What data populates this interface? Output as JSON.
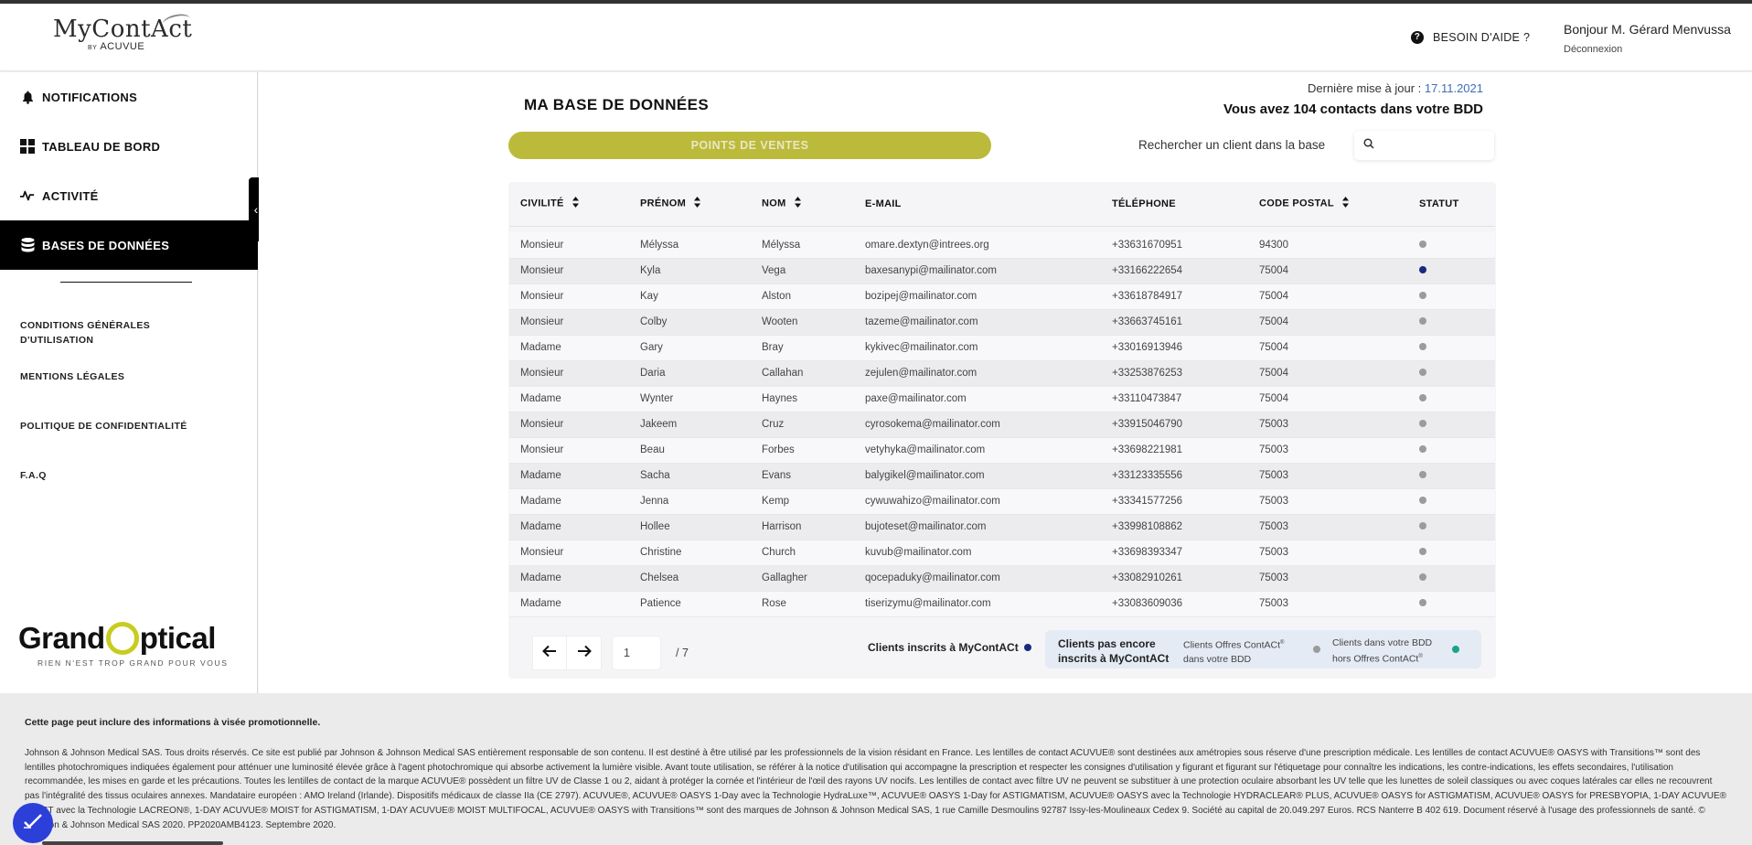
{
  "header": {
    "logo_main": "MyContAct",
    "logo_by": "BY",
    "logo_brand": "ACUVUE",
    "help_label": "BESOIN D'AIDE ?",
    "help_icon_text": "?",
    "greeting": "Bonjour M. Gérard Menvussa",
    "logout_label": "Déconnexion"
  },
  "sidebar": {
    "nav": [
      {
        "label": "NOTIFICATIONS",
        "icon": "bell-icon"
      },
      {
        "label": "TABLEAU DE BORD",
        "icon": "dashboard-grid-icon"
      },
      {
        "label": "ACTIVITÉ",
        "icon": "activity-pulse-icon"
      },
      {
        "label": "BASES DE DONNÉES",
        "icon": "database-icon",
        "active": true
      }
    ],
    "links": [
      {
        "line1": "CONDITIONS GÉNÉRALES",
        "line2": "D'UTILISATION"
      },
      {
        "line1": "MENTIONS LÉGALES"
      },
      {
        "line1": "POLITIQUE DE CONFIDENTIALITÉ"
      },
      {
        "line1": "F.A.Q"
      }
    ],
    "collapse_glyph": "‹",
    "partner_logo": {
      "pre": "Grand",
      "post": "ptical",
      "tagline": "RIEN N'EST TROP GRAND POUR VOUS",
      "accent": "#c8cc1f"
    }
  },
  "main": {
    "title": "MA BASE DE DONNÉES",
    "update_prefix": "Dernière mise à jour : ",
    "update_date": "17.11.2021",
    "contacts_text": "Vous avez 104 contacts dans votre BDD",
    "tab_label": "POINTS DE VENTES",
    "search_label": "Rechercher un client dans la base",
    "search_placeholder": ""
  },
  "table": {
    "columns": [
      "CIVILITÉ",
      "PRÉNOM",
      "NOM",
      "E-MAIL",
      "TÉLÉPHONE",
      "CODE POSTAL",
      "STATUT"
    ],
    "sortable": [
      true,
      true,
      true,
      false,
      false,
      true,
      false
    ],
    "rows": [
      [
        "Monsieur",
        "Mélyssa",
        "Mélyssa",
        "omare.dextyn@intrees.org",
        "+33631670951",
        "94300",
        "grey"
      ],
      [
        "Monsieur",
        "Kyla",
        "Vega",
        "baxesanypi@mailinator.com",
        "+33166222654",
        "75004",
        "navy"
      ],
      [
        "Monsieur",
        "Kay",
        "Alston",
        "bozipej@mailinator.com",
        "+33618784917",
        "75004",
        "grey"
      ],
      [
        "Monsieur",
        "Colby",
        "Wooten",
        "tazeme@mailinator.com",
        "+33663745161",
        "75004",
        "grey"
      ],
      [
        "Madame",
        "Gary",
        "Bray",
        "kykivec@mailinator.com",
        "+33016913946",
        "75004",
        "grey"
      ],
      [
        "Monsieur",
        "Daria",
        "Callahan",
        "zejulen@mailinator.com",
        "+33253876253",
        "75004",
        "grey"
      ],
      [
        "Madame",
        "Wynter",
        "Haynes",
        "paxe@mailinator.com",
        "+33110473847",
        "75004",
        "grey"
      ],
      [
        "Monsieur",
        "Jakeem",
        "Cruz",
        "cyrosokema@mailinator.com",
        "+33915046790",
        "75003",
        "grey"
      ],
      [
        "Monsieur",
        "Beau",
        "Forbes",
        "vetyhyka@mailinator.com",
        "+33698221981",
        "75003",
        "grey"
      ],
      [
        "Madame",
        "Sacha",
        "Evans",
        "balygikel@mailinator.com",
        "+33123335556",
        "75003",
        "grey"
      ],
      [
        "Madame",
        "Jenna",
        "Kemp",
        "cywuwahizo@mailinator.com",
        "+33341577256",
        "75003",
        "grey"
      ],
      [
        "Madame",
        "Hollee",
        "Harrison",
        "bujoteset@mailinator.com",
        "+33998108862",
        "75003",
        "grey"
      ],
      [
        "Monsieur",
        "Christine",
        "Church",
        "kuvub@mailinator.com",
        "+33698393347",
        "75003",
        "grey"
      ],
      [
        "Madame",
        "Chelsea",
        "Gallagher",
        "qocepaduky@mailinator.com",
        "+33082910261",
        "75003",
        "grey"
      ],
      [
        "Madame",
        "Patience",
        "Rose",
        "tiserizymu@mailinator.com",
        "+33083609036",
        "75003",
        "grey"
      ]
    ]
  },
  "pagination": {
    "prev_glyph": "←",
    "next_glyph": "→",
    "current_page": "1",
    "total_pages": "/ 7"
  },
  "legend": {
    "registered": "Clients inscrits à MyContACt",
    "not_registered_line1": "Clients pas encore",
    "not_registered_line2": "inscrits à MyContACt",
    "offers_line1": "Clients Offres ContACt",
    "offers_line2": "dans votre BDD",
    "outside_line1": "Clients dans votre BDD",
    "outside_line2": "hors Offres ContACt",
    "registered_sup": "®",
    "colors": {
      "navy": "#1a2a7c",
      "grey": "#9b9b9b",
      "teal": "#1aa38c"
    }
  },
  "footer": {
    "heading": "Cette page peut inclure des informations à visée promotionnelle.",
    "body": "Johnson & Johnson Medical SAS. Tous droits réservés. Ce site est publié par Johnson & Johnson Medical SAS entièrement responsable de son contenu. Il est destiné à être utilisé par les professionnels de la vision résidant en France. Les lentilles de contact ACUVUE® sont destinées aux amétropies sous réserve d'une prescription médicale. Les lentilles de contact ACUVUE® OASYS with Transitions™ sont des lentilles photochromiques indiquées également pour atténuer une luminosité élevée grâce à l'agent photochromique qui absorbe activement la lumière visible. Avant toute utilisation, se référer à la notice d'utilisation qui accompagne la prescription et respecter les consignes d'utilisation y figurant et figurant sur l'étiquetage pour connaître les indications, les contre-indications, les effets secondaires, l'utilisation recommandée, les mises en garde et les précautions. Toutes les lentilles de contact de la marque ACUVUE® possèdent un filtre UV de Classe 1 ou 2, aidant à protéger la cornée et l'intérieur de l'œil des rayons UV nocifs. Les lentilles de contact avec filtre UV ne peuvent se substituer à une protection oculaire absorbant les UV telle que les lunettes de soleil classiques ou avec coques latérales car elles ne recouvrent pas l'intégralité des tissus oculaires annexes. Mandataire européen : AMO Ireland (Irlande). Dispositifs médicaux de classe IIa (CE 2797). ACUVUE®, ACUVUE® OASYS 1-Day avec la Technologie HydraLuxe™, ACUVUE® OASYS 1-Day for ASTIGMATISM, ACUVUE® OASYS avec la Technologie HYDRACLEAR® PLUS, ACUVUE® OASYS for ASTIGMATISM, ACUVUE® OASYS for PRESBYOPIA, 1-DAY ACUVUE® MOIST avec la Technologie LACREON®, 1-DAY ACUVUE® MOIST for ASTIGMATISM, 1-DAY ACUVUE® MOIST MULTIFOCAL, ACUVUE® OASYS with Transitions™ sont des marques de Johnson & Johnson Medical SAS, 1 rue Camille Desmoulins 92787 Issy-les-Moulineaux Cedex 9. Société au capital de 20.049.297 Euros. RCS Nanterre B 402 619. Document réservé à l'usage des professionnels de santé. © Johnson & Johnson Medical SAS 2020. PP2020AMB4123. Septembre 2020."
  },
  "colors": {
    "accent_olive": "#bcba3b",
    "link_blue": "#3d6fb8",
    "fab_blue": "#2d3fd9"
  }
}
